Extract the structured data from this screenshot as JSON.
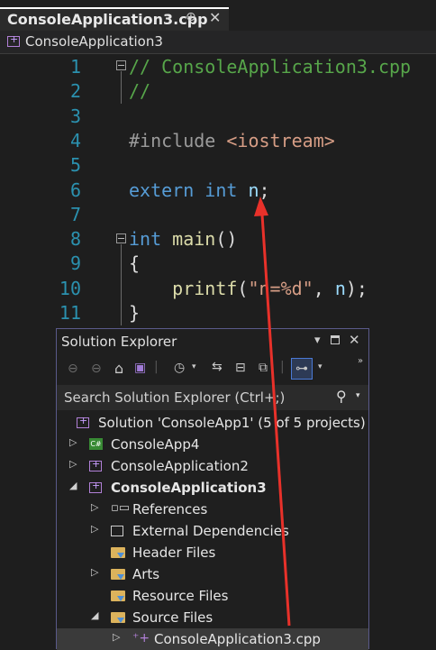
{
  "tab": {
    "title": "ConsoleApplication3.cpp",
    "pin": "⊕",
    "close": "✕"
  },
  "navbar": {
    "project": "ConsoleApplication3"
  },
  "editor": {
    "line_numbers": [
      "1",
      "2",
      "3",
      "4",
      "5",
      "6",
      "7",
      "8",
      "9",
      "10",
      "11"
    ],
    "lines": [
      [
        {
          "c": "cm",
          "t": "// ConsoleApplication3.cpp"
        }
      ],
      [
        {
          "c": "cm",
          "t": "//"
        }
      ],
      [],
      [
        {
          "c": "pp",
          "t": "#include "
        },
        {
          "c": "st",
          "t": "<iostream>"
        }
      ],
      [],
      [
        {
          "c": "kw",
          "t": "extern "
        },
        {
          "c": "kw",
          "t": "int "
        },
        {
          "c": "id",
          "t": "n"
        },
        {
          "c": "",
          "t": ";"
        }
      ],
      [],
      [
        {
          "c": "kw",
          "t": "int "
        },
        {
          "c": "fn",
          "t": "main"
        },
        {
          "c": "",
          "t": "()"
        }
      ],
      [
        {
          "c": "",
          "t": "{"
        }
      ],
      [
        {
          "c": "",
          "t": "    "
        },
        {
          "c": "fn",
          "t": "printf"
        },
        {
          "c": "",
          "t": "("
        },
        {
          "c": "st",
          "t": "\"n=%d\""
        },
        {
          "c": "",
          "t": ", "
        },
        {
          "c": "id",
          "t": "n"
        },
        {
          "c": "",
          "t": ");"
        }
      ],
      [
        {
          "c": "",
          "t": "}"
        }
      ]
    ]
  },
  "solution_explorer": {
    "title": "Solution Explorer",
    "pin_icon": "▾",
    "search_placeholder": "Search Solution Explorer (Ctrl+;)",
    "tree": [
      {
        "label": "Solution 'ConsoleApp1' (5 of 5 projects)",
        "indent": 0,
        "arrow": "",
        "icon": "solution-icon"
      },
      {
        "label": "ConsoleApp4",
        "indent": 1,
        "arrow": "▷",
        "icon": "csharp-project-icon"
      },
      {
        "label": "ConsoleApplication2",
        "indent": 1,
        "arrow": "▷",
        "icon": "cpp-project-icon"
      },
      {
        "label": "ConsoleApplication3",
        "indent": 1,
        "arrow": "◢",
        "icon": "cpp-project-icon",
        "bold": true
      },
      {
        "label": "References",
        "indent": 2,
        "arrow": "▷",
        "icon": "references-icon"
      },
      {
        "label": "External Dependencies",
        "indent": 2,
        "arrow": "▷",
        "icon": "external-deps-icon"
      },
      {
        "label": "Header Files",
        "indent": 2,
        "arrow": "",
        "icon": "filter-folder-icon"
      },
      {
        "label": "Arts",
        "indent": 2,
        "arrow": "▷",
        "icon": "filter-folder-icon"
      },
      {
        "label": "Resource Files",
        "indent": 2,
        "arrow": "",
        "icon": "filter-folder-icon"
      },
      {
        "label": "Source Files",
        "indent": 2,
        "arrow": "◢",
        "icon": "filter-folder-icon"
      },
      {
        "label": "ConsoleApplication3.cpp",
        "indent": 3,
        "arrow": "▷",
        "icon": "cpp-file-icon",
        "selected": true
      }
    ]
  },
  "colors": {
    "accent_arrow": "#e8312a",
    "comment": "#57a64a",
    "keyword": "#569cd6"
  }
}
